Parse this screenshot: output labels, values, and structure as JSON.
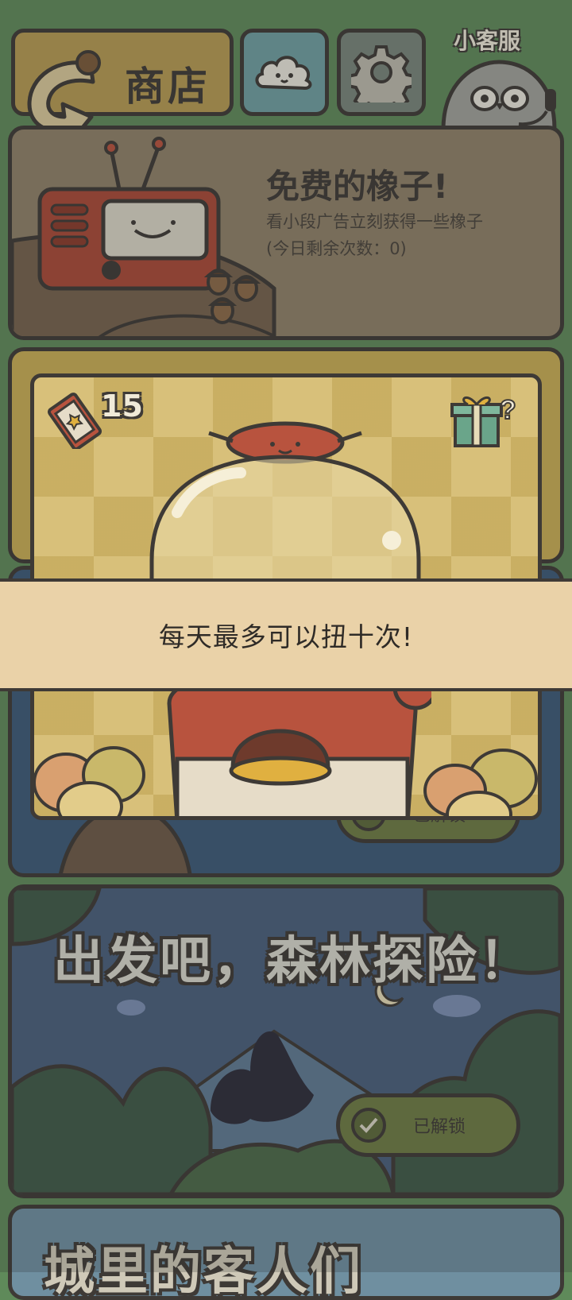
{
  "topbar": {
    "shop_label": "商店",
    "service_label": "小客服"
  },
  "free_acorns": {
    "title": "免费的橡子!",
    "description": "看小段广告立刻获得一些橡子",
    "remaining": "(今日剩余次数：0)"
  },
  "gacha": {
    "ticket_count": "15",
    "notice": "每天最多可以扭十次!"
  },
  "unlock_status_behind": "已解锁",
  "forest": {
    "title": "出发吧，森林探险！",
    "status": "已解锁"
  },
  "city": {
    "title": "城里的客人们"
  },
  "colors": {
    "outline": "#3e3a36",
    "banner_bg": "#ead2a8",
    "background": "#5f8a5a"
  }
}
